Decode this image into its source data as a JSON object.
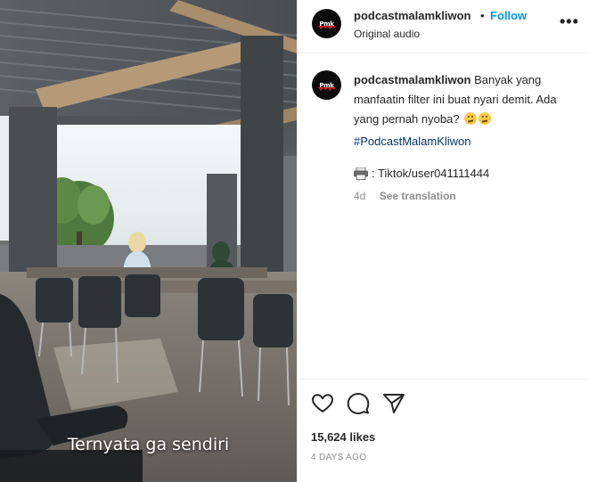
{
  "post": {
    "username": "podcastmalamkliwon",
    "separator": "•",
    "follow_label": "Follow",
    "audio_label": "Original audio",
    "more_label": "•••",
    "avatar_mark": "Pmk"
  },
  "media": {
    "caption_overlay": "Ternyata ga sendiri"
  },
  "caption": {
    "username": "podcastmalamkliwon",
    "text": "Banyak yang manfaatin filter ini buat nyari demit. Ada yang pernah nyoba?",
    "emojis": [
      "thinking-face-emoji",
      "thinking-face-emoji"
    ],
    "hashtag": "#PodcastMalamKliwon",
    "tiktok_text": ": Tiktok/user041111444",
    "tiktok_icon": "printer-icon",
    "age": "4d",
    "translate_label": "See translation"
  },
  "actions": {
    "icons": [
      "heart-icon",
      "comment-icon",
      "share-icon"
    ],
    "likes": "15,624 likes",
    "date": "4 DAYS AGO"
  },
  "colors": {
    "follow": "#0095f6",
    "hashtag": "#00376b",
    "muted": "#8e8e8e",
    "text": "#262626"
  }
}
